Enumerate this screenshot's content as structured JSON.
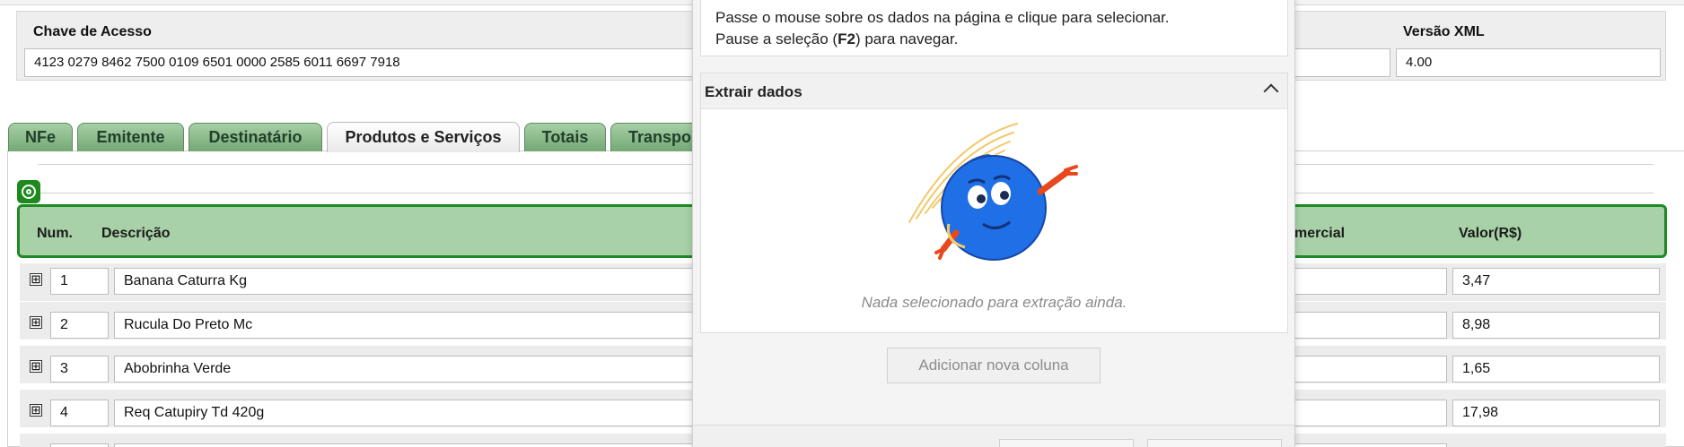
{
  "header": {
    "access_key_label": "Chave de Acesso",
    "access_key_value": "4123 0279 8462 7500 0109 6501 0000 2585 6011 6697 7918",
    "xml_version_label": "Versão XML",
    "xml_version_value": "4.00"
  },
  "tabs": [
    {
      "label": "NFe"
    },
    {
      "label": "Emitente"
    },
    {
      "label": "Destinatário"
    },
    {
      "label": "Produtos e Serviços",
      "active": true
    },
    {
      "label": "Totais"
    },
    {
      "label": "Transpo"
    }
  ],
  "table": {
    "headers": {
      "num": "Num.",
      "descricao": "Descrição",
      "comercial": "mercial",
      "valor": "Valor(R$)"
    },
    "rows": [
      {
        "num": "1",
        "descricao": "Banana Caturra Kg",
        "valor": "3,47"
      },
      {
        "num": "2",
        "descricao": "Rucula Do Preto Mc",
        "valor": "8,98"
      },
      {
        "num": "3",
        "descricao": "Abobrinha Verde",
        "valor": "1,65"
      },
      {
        "num": "4",
        "descricao": "Req Catupiry Td 420g",
        "valor": "17,98"
      }
    ],
    "expand_symbol": "⊞"
  },
  "popup": {
    "instruction_line1": "Passe o mouse sobre os dados na página e clique para selecionar.",
    "instruction_line2_pre": "Pause a seleção (",
    "instruction_line2_key": "F2",
    "instruction_line2_post": ") para navegar.",
    "section_title": "Extrair dados",
    "empty_message": "Nada selecionado para extração ainda.",
    "add_column_button": "Adicionar nova coluna"
  },
  "colors": {
    "tab_green": "#74a874",
    "header_green_bg": "#a8d1a8",
    "header_green_border": "#1f8a24",
    "mascot_blue": "#1f6fe6",
    "mascot_orange": "#e8481c"
  }
}
